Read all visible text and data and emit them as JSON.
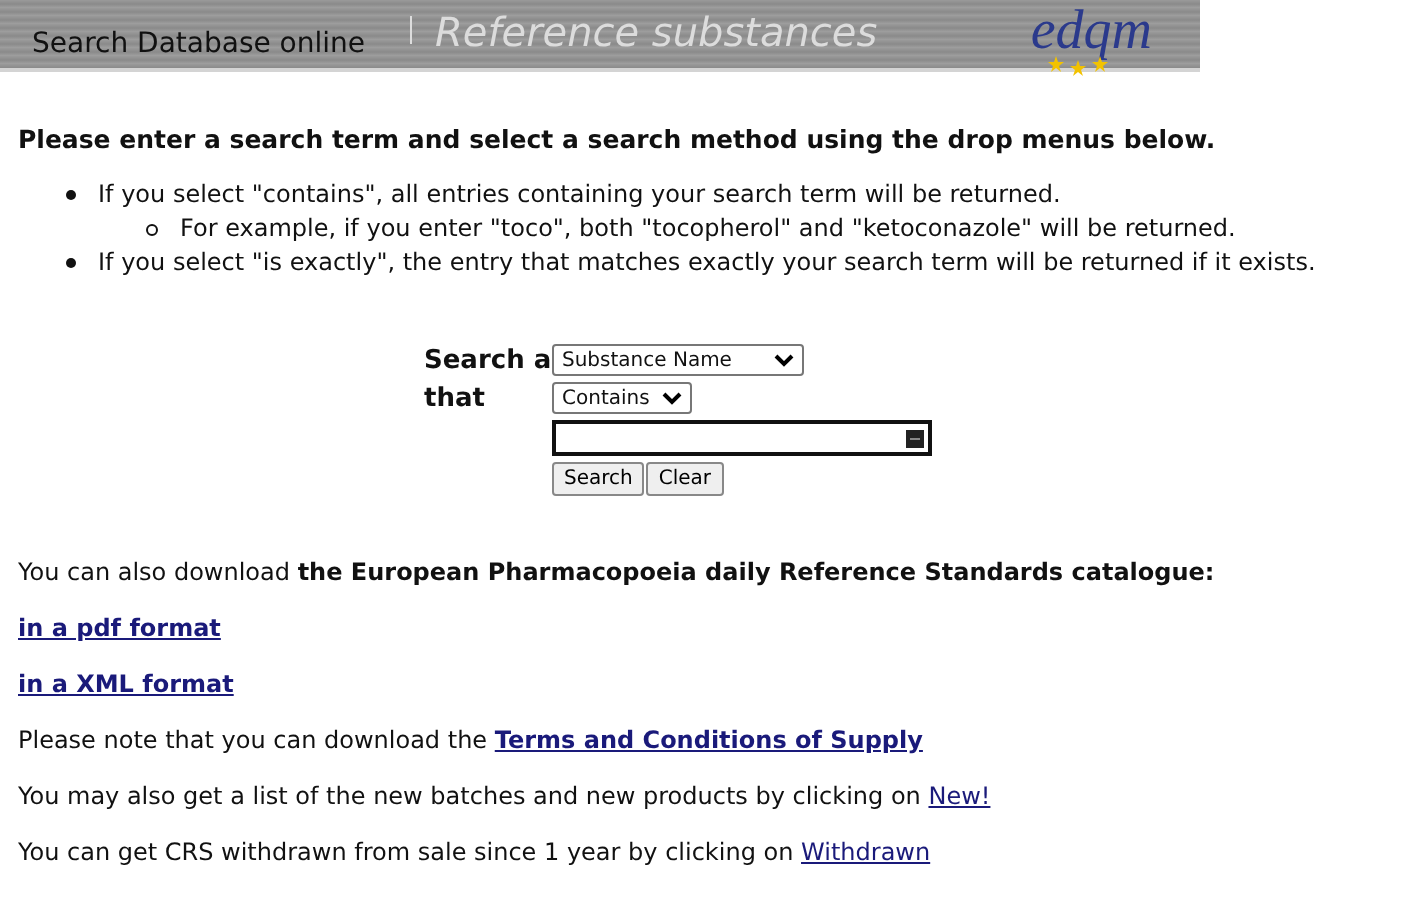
{
  "header": {
    "title": "Search Database online",
    "subtitle": "Reference substances",
    "logo": "edqm"
  },
  "intro": "Please enter a search term and select a search method using the drop menus below.",
  "bullets": [
    {
      "text": "If you select \"contains\", all entries containing your search term will be returned.",
      "children": [
        {
          "text": "For example, if you enter \"toco\", both \"tocopherol\" and \"ketoconazole\" will be returned."
        }
      ]
    },
    {
      "text": "If you select \"is exactly\", the entry that matches exactly your search term will be returned if it exists."
    }
  ],
  "form": {
    "label_1": "Search a",
    "label_2": "that",
    "field_select": "Substance Name",
    "method_select": "Contains",
    "search_button": "Search",
    "clear_button": "Clear"
  },
  "catalogue": "You can also download **the European Pharmacopoeia daily Reference Standards catalogue:**",
  "downloads": [
    "in a pdf format",
    "in a XML format"
  ],
  "notes": [
    {
      "text": "Please note that you can download the ",
      "link": "Terms and Conditions of Supply",
      "bold": true
    },
    {
      "text": "You may also get a list of the new batches and new products by clicking on ",
      "link": "New!",
      "bold": false
    },
    {
      "text": "You can get CRS withdrawn from sale since 1 year by clicking on ",
      "link": "Withdrawn",
      "bold": false
    }
  ]
}
